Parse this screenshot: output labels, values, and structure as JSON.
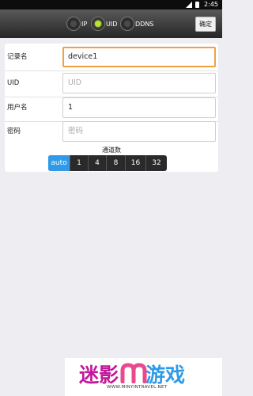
{
  "status_bar": {
    "time": "2:45"
  },
  "toolbar": {
    "modes": [
      {
        "label": "IP",
        "selected": false
      },
      {
        "label": "UID",
        "selected": true
      },
      {
        "label": "DDNS",
        "selected": false
      }
    ],
    "confirm_label": "确定"
  },
  "form": {
    "record_name": {
      "label": "记录名",
      "value": "device1"
    },
    "uid": {
      "label": "UID",
      "placeholder": "UID",
      "value": ""
    },
    "username": {
      "label": "用户名",
      "value": "1"
    },
    "password": {
      "label": "密码",
      "placeholder": "密码",
      "value": ""
    }
  },
  "channels": {
    "title": "通道数",
    "options": [
      "auto",
      "1",
      "4",
      "8",
      "16",
      "32"
    ],
    "selected": "auto"
  },
  "watermark": {
    "text_part1": "迷影",
    "text_part2": "游戏",
    "url": "WWW.MINYINTRAVEL.NET",
    "colors": {
      "magenta": "#c0179b",
      "pink": "#e84a8e",
      "blue": "#2f9be8"
    }
  },
  "colors": {
    "accent": "#2f9be8",
    "focus_border": "#f1a240",
    "radio_active": "#b6e33a"
  }
}
